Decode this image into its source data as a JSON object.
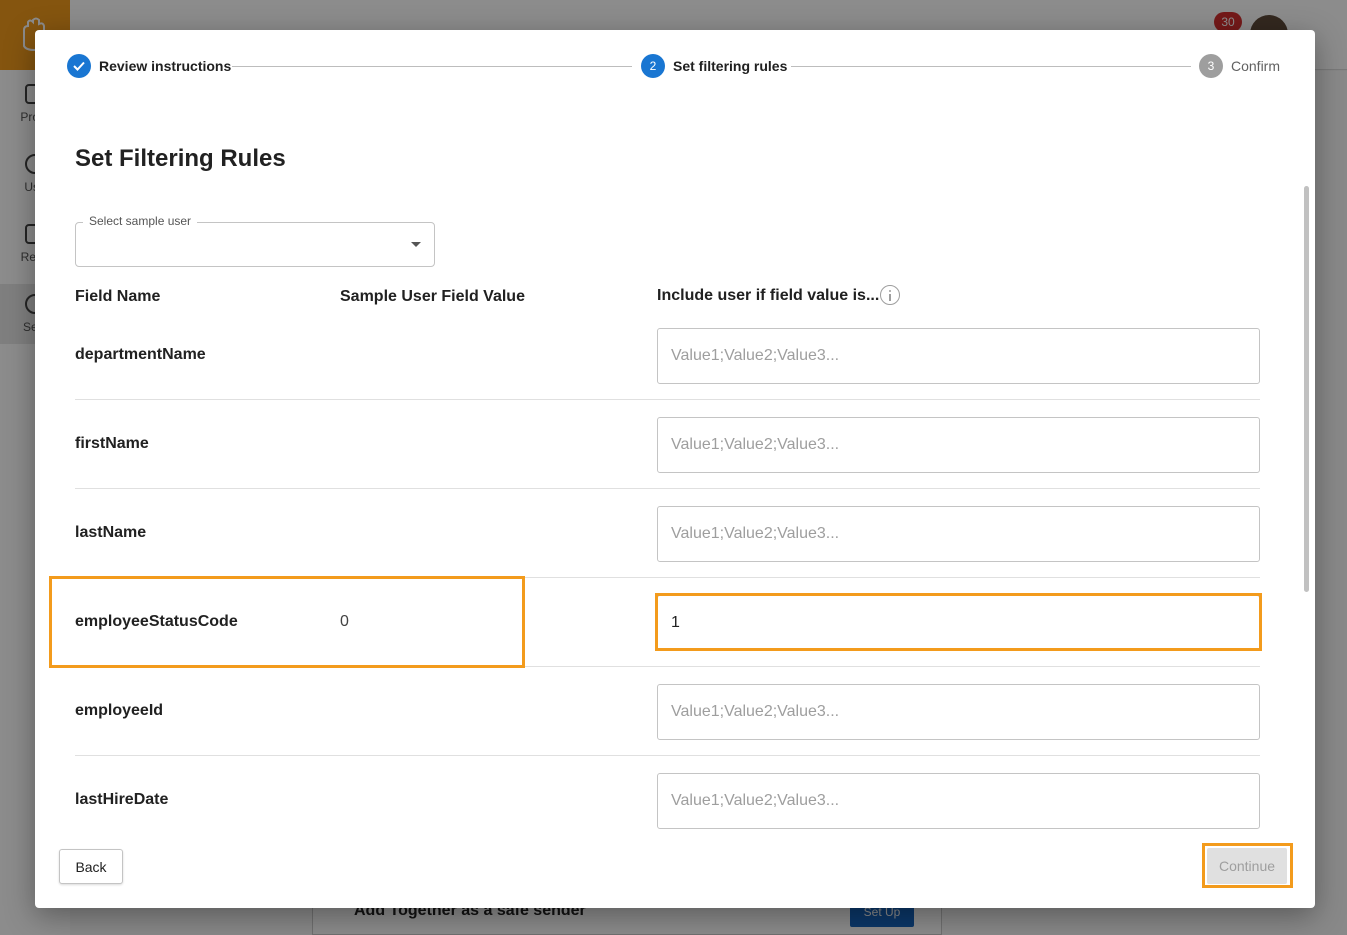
{
  "background": {
    "sidebar": [
      {
        "label": "Progr"
      },
      {
        "label": "Use"
      },
      {
        "label": "Repo"
      },
      {
        "label": "Setti"
      }
    ],
    "notification_count": "30",
    "card_title": "Add Together as a safe sender",
    "card_button": "Set Up"
  },
  "stepper": {
    "steps": [
      {
        "label": "Review instructions",
        "state": "completed"
      },
      {
        "label": "Set filtering rules",
        "number": "2",
        "state": "active"
      },
      {
        "label": "Confirm",
        "number": "3",
        "state": "pending"
      }
    ]
  },
  "modal": {
    "title": "Set Filtering Rules",
    "sample_user_label": "Select sample user",
    "sample_user_value": ""
  },
  "table": {
    "headers": {
      "field_name": "Field Name",
      "sample_value": "Sample User Field Value",
      "include_if": "Include user if field value is..."
    },
    "rows": [
      {
        "field": "departmentName",
        "sample": "",
        "input_value": "",
        "placeholder": "Value1;Value2;Value3..."
      },
      {
        "field": "firstName",
        "sample": "",
        "input_value": "",
        "placeholder": "Value1;Value2;Value3..."
      },
      {
        "field": "lastName",
        "sample": "",
        "input_value": "",
        "placeholder": "Value1;Value2;Value3..."
      },
      {
        "field": "employeeStatusCode",
        "sample": "0",
        "input_value": "1",
        "placeholder": "Value1;Value2;Value3..."
      },
      {
        "field": "employeeId",
        "sample": "",
        "input_value": "",
        "placeholder": "Value1;Value2;Value3..."
      },
      {
        "field": "lastHireDate",
        "sample": "",
        "input_value": "",
        "placeholder": "Value1;Value2;Value3..."
      }
    ]
  },
  "footer": {
    "back_label": "Back",
    "continue_label": "Continue"
  },
  "colors": {
    "accent": "#1976d2",
    "highlight": "#f39b1c",
    "brand": "#f39b1c"
  }
}
